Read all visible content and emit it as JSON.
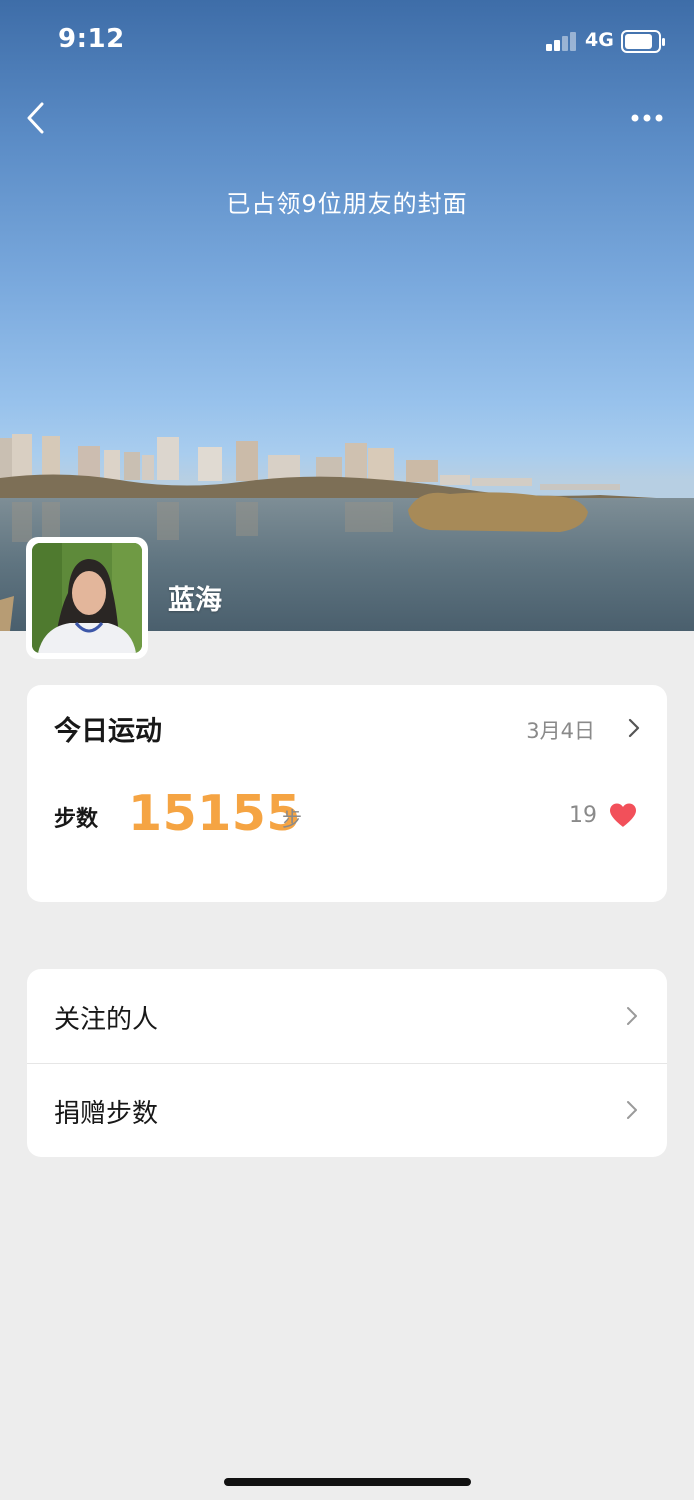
{
  "status_bar": {
    "time": "9:12",
    "network": "4G"
  },
  "nav": {
    "back_icon": "chevron-left-icon",
    "more_icon": "more-dots-icon"
  },
  "hero": {
    "cover_title": "已占领9位朋友的封面",
    "username": "蓝海"
  },
  "today_card": {
    "title": "今日运动",
    "date": "3月4日",
    "steps_label": "步数",
    "steps_value": "15155",
    "steps_unit": "步",
    "likes_count": "19",
    "heart_color": "#f2505a",
    "steps_color": "#f5a443"
  },
  "menu": {
    "items": [
      {
        "label": "关注的人"
      },
      {
        "label": "捐赠步数"
      }
    ]
  }
}
